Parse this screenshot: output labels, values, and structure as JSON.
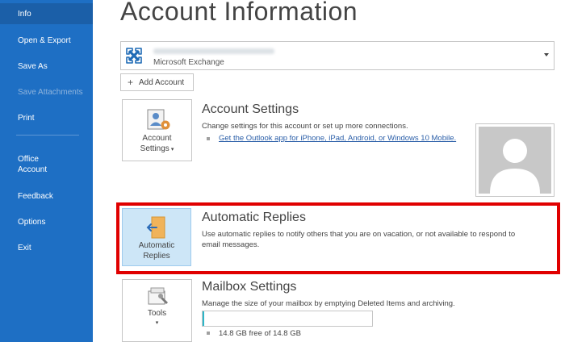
{
  "sidebar": {
    "items": [
      {
        "label": "Info"
      },
      {
        "label": "Open & Export"
      },
      {
        "label": "Save As"
      },
      {
        "label": "Save Attachments"
      },
      {
        "label": "Print"
      },
      {
        "label_line1": "Office",
        "label_line2": "Account"
      },
      {
        "label": "Feedback"
      },
      {
        "label": "Options"
      },
      {
        "label": "Exit"
      }
    ]
  },
  "main": {
    "title": "Account Information",
    "account_selector": {
      "type": "Microsoft Exchange"
    },
    "add_account_label": "Add Account",
    "account_settings": {
      "tile_line1": "Account",
      "tile_line2": "Settings",
      "title": "Account Settings",
      "description": "Change settings for this account or set up more connections.",
      "link": "Get the Outlook app for iPhone, iPad, Android, or Windows 10 Mobile."
    },
    "automatic_replies": {
      "tile_line1": "Automatic",
      "tile_line2": "Replies",
      "title": "Automatic Replies",
      "description_line1": "Use automatic replies to notify others that you are on vacation, or not available to respond to",
      "description_line2": "email messages."
    },
    "mailbox_settings": {
      "tile_label": "Tools",
      "title": "Mailbox Settings",
      "description": "Manage the size of your mailbox by emptying Deleted Items and archiving.",
      "storage_text": "14.8 GB free of 14.8 GB",
      "used_fraction": 0.01
    }
  },
  "colors": {
    "sidebar": "#1e6fc4",
    "highlight": "#e00000",
    "storage_bar": "#2cb7c9"
  }
}
